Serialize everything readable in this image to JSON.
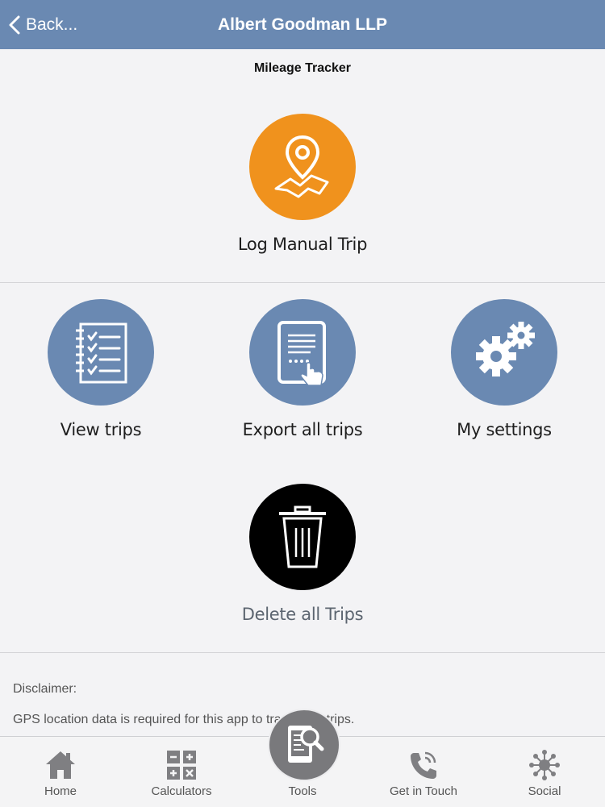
{
  "header": {
    "back_label": "Back...",
    "title": "Albert Goodman LLP"
  },
  "page": {
    "subtitle": "Mileage Tracker"
  },
  "actions": {
    "log_manual_trip": "Log Manual Trip",
    "view_trips": "View trips",
    "export_all_trips": "Export all trips",
    "my_settings": "My settings",
    "delete_all_trips": "Delete all Trips"
  },
  "disclaimer": {
    "title": "Disclaimer:",
    "text": "GPS location data is required for this app to track your trips."
  },
  "tabbar": {
    "items": [
      {
        "label": "Home",
        "icon": "home-icon"
      },
      {
        "label": "Calculators",
        "icon": "calculator-icon"
      },
      {
        "label": "Tools",
        "icon": "tools-icon"
      },
      {
        "label": "Get in Touch",
        "icon": "phone-icon"
      },
      {
        "label": "Social",
        "icon": "social-network-icon"
      }
    ]
  },
  "colors": {
    "header": "#6a89b2",
    "accent_orange": "#f0921d",
    "delete": "#000000",
    "tab_bubble": "#79797c"
  }
}
